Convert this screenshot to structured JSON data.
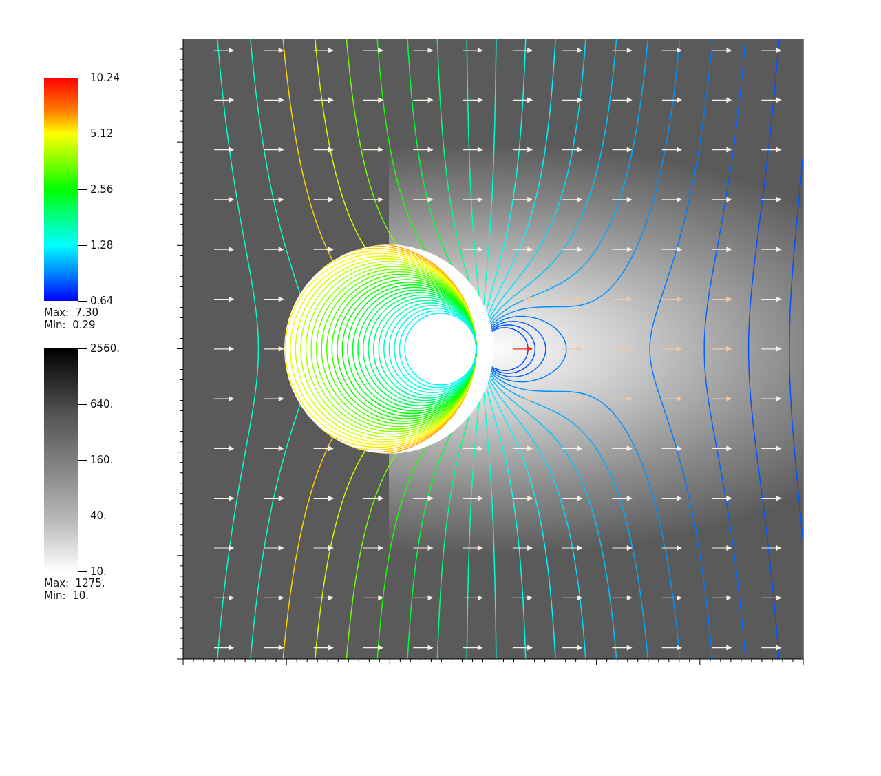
{
  "legends": [
    {
      "kind": "rainbow",
      "ticks": [
        "10.24",
        "5.12",
        "2.56",
        "1.28",
        "0.64"
      ],
      "max": "Max:  7.30",
      "min": "Min:  0.29"
    },
    {
      "kind": "grayscale",
      "ticks": [
        "2560.",
        "640.",
        "160.",
        "40.",
        "10."
      ],
      "max": "Max:  1275.",
      "min": "Min:  10."
    }
  ]
}
